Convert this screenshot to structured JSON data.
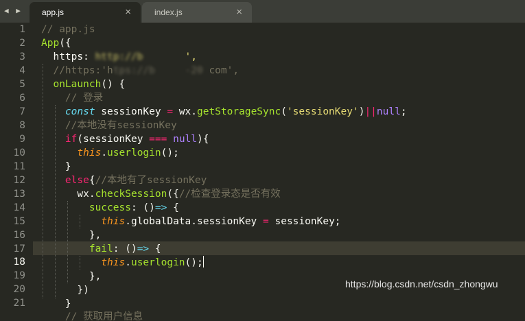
{
  "tabs": [
    {
      "label": "app.js",
      "active": true
    },
    {
      "label": "index.js",
      "active": false
    }
  ],
  "nav_arrows": "◀ ▶",
  "close_glyph": "×",
  "line_numbers": [
    "1",
    "2",
    "3",
    "4",
    "5",
    "6",
    "7",
    "8",
    "9",
    "10",
    "11",
    "12",
    "13",
    "14",
    "15",
    "16",
    "17",
    "18",
    "19",
    "20",
    "21"
  ],
  "current_line": "18",
  "code": {
    "l1": "// app.js",
    "l2": {
      "a": "App",
      "b": "({"
    },
    "l3": {
      "a": "  https: ",
      "b": "http://b       ",
      "c": "',"
    },
    "l4": {
      "a": "  //https:'h",
      "b": "tps://b     -20",
      "c": " com',"
    },
    "l5": {
      "a": "  ",
      "b": "onLaunch",
      "c": "() {"
    },
    "l6": "    // 登录",
    "l7": {
      "a": "    ",
      "b": "const",
      "c": " sessionKey ",
      "d": "=",
      "e": " wx.",
      "f": "getStorageSync",
      "g": "(",
      "h": "'sessionKey'",
      "i": ")",
      "j": "||",
      "k": "null",
      "l": ";"
    },
    "l8": "    //本地没有sessionKey",
    "l9": {
      "a": "    ",
      "b": "if",
      "c": "(sessionKey ",
      "d": "===",
      "e": " ",
      "f": "null",
      "g": "){"
    },
    "l10": {
      "a": "      ",
      "b": "this",
      "c": ".",
      "d": "userlogin",
      "e": "();"
    },
    "l11": "    }",
    "l12": {
      "a": "    ",
      "b": "else",
      "c": "{",
      "d": "//本地有了sessionKey"
    },
    "l13": {
      "a": "      wx.",
      "b": "checkSession",
      "c": "({",
      "d": "//检查登录态是否有效"
    },
    "l14": {
      "a": "        ",
      "b": "success",
      "c": ": ()",
      "d": "=>",
      "e": " {"
    },
    "l15": {
      "a": "          ",
      "b": "this",
      "c": ".globalData.sessionKey ",
      "d": "=",
      "e": " sessionKey;"
    },
    "l16": "        },",
    "l17": {
      "a": "        ",
      "b": "fail",
      "c": ": ()",
      "d": "=>",
      "e": " {"
    },
    "l18": {
      "a": "          ",
      "b": "this",
      "c": ".",
      "d": "userlogin",
      "e": "();"
    },
    "l19": "        },",
    "l20": "      })",
    "l21": "    }",
    "l22": "    // 获取用户信息"
  },
  "watermark": "https://blog.csdn.net/csdn_zhongwu",
  "colors": {
    "background": "#272822",
    "comment": "#75715e",
    "keyword": "#f92672",
    "storage": "#66d9ef",
    "function": "#a6e22e",
    "string": "#e6db74",
    "number": "#ae81ff",
    "this": "#fd971f"
  }
}
